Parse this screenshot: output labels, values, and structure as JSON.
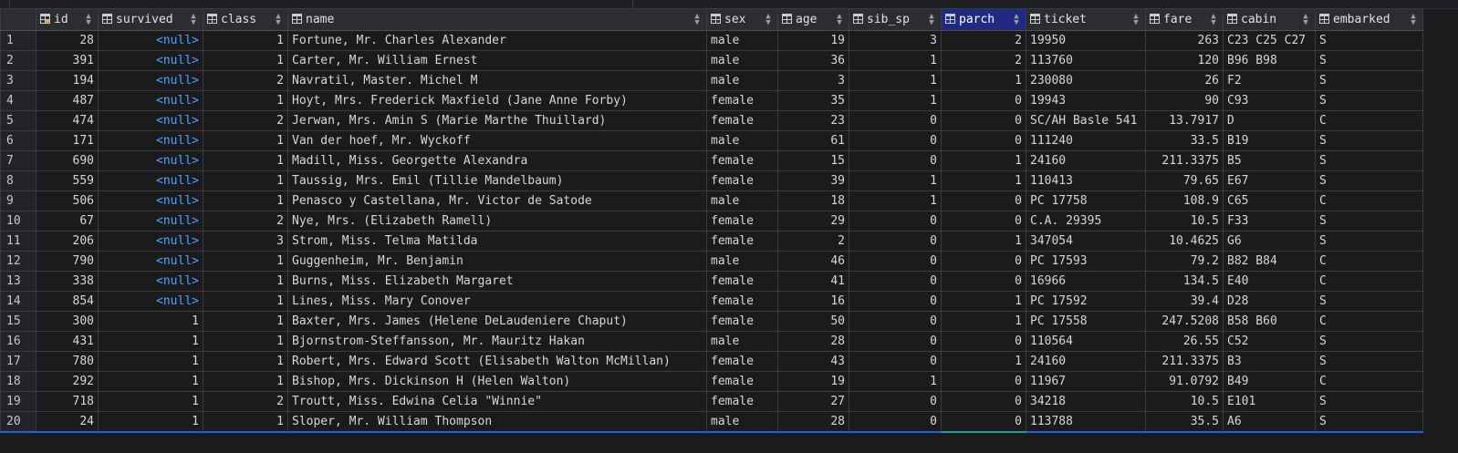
{
  "columns": [
    {
      "key": "rownum",
      "label": "",
      "align": "left",
      "icon": "none"
    },
    {
      "key": "id",
      "label": "id",
      "align": "right",
      "icon": "key-column-icon"
    },
    {
      "key": "survived",
      "label": "survived",
      "align": "right",
      "icon": "column-icon"
    },
    {
      "key": "class",
      "label": "class",
      "align": "right",
      "icon": "column-icon"
    },
    {
      "key": "name",
      "label": "name",
      "align": "left",
      "icon": "column-icon"
    },
    {
      "key": "sex",
      "label": "sex",
      "align": "left",
      "icon": "column-icon"
    },
    {
      "key": "age",
      "label": "age",
      "align": "right",
      "icon": "column-icon"
    },
    {
      "key": "sib_sp",
      "label": "sib_sp",
      "align": "right",
      "icon": "column-icon"
    },
    {
      "key": "parch",
      "label": "parch",
      "align": "right",
      "icon": "column-icon",
      "selected": true
    },
    {
      "key": "ticket",
      "label": "ticket",
      "align": "left",
      "icon": "column-icon"
    },
    {
      "key": "fare",
      "label": "fare",
      "align": "right",
      "icon": "column-icon"
    },
    {
      "key": "cabin",
      "label": "cabin",
      "align": "left",
      "icon": "column-icon"
    },
    {
      "key": "embarked",
      "label": "embarked",
      "align": "left",
      "icon": "column-icon"
    }
  ],
  "null_label": "<null>",
  "rows": [
    [
      "1",
      "28",
      null,
      "1",
      "Fortune, Mr. Charles Alexander",
      "male",
      "19",
      "3",
      "2",
      "19950",
      "263",
      "C23 C25 C27",
      "S"
    ],
    [
      "2",
      "391",
      null,
      "1",
      "Carter, Mr. William Ernest",
      "male",
      "36",
      "1",
      "2",
      "113760",
      "120",
      "B96 B98",
      "S"
    ],
    [
      "3",
      "194",
      null,
      "2",
      "Navratil, Master. Michel M",
      "male",
      "3",
      "1",
      "1",
      "230080",
      "26",
      "F2",
      "S"
    ],
    [
      "4",
      "487",
      null,
      "1",
      "Hoyt, Mrs. Frederick Maxfield (Jane Anne Forby)",
      "female",
      "35",
      "1",
      "0",
      "19943",
      "90",
      "C93",
      "S"
    ],
    [
      "5",
      "474",
      null,
      "2",
      "Jerwan, Mrs. Amin S (Marie Marthe Thuillard)",
      "female",
      "23",
      "0",
      "0",
      "SC/AH Basle 541",
      "13.7917",
      "D",
      "C"
    ],
    [
      "6",
      "171",
      null,
      "1",
      "Van der hoef, Mr. Wyckoff",
      "male",
      "61",
      "0",
      "0",
      "111240",
      "33.5",
      "B19",
      "S"
    ],
    [
      "7",
      "690",
      null,
      "1",
      "Madill, Miss. Georgette Alexandra",
      "female",
      "15",
      "0",
      "1",
      "24160",
      "211.3375",
      "B5",
      "S"
    ],
    [
      "8",
      "559",
      null,
      "1",
      "Taussig, Mrs. Emil (Tillie Mandelbaum)",
      "female",
      "39",
      "1",
      "1",
      "110413",
      "79.65",
      "E67",
      "S"
    ],
    [
      "9",
      "506",
      null,
      "1",
      "Penasco y Castellana, Mr. Victor de Satode",
      "male",
      "18",
      "1",
      "0",
      "PC 17758",
      "108.9",
      "C65",
      "C"
    ],
    [
      "10",
      "67",
      null,
      "2",
      "Nye, Mrs. (Elizabeth Ramell)",
      "female",
      "29",
      "0",
      "0",
      "C.A. 29395",
      "10.5",
      "F33",
      "S"
    ],
    [
      "11",
      "206",
      null,
      "3",
      "Strom, Miss. Telma Matilda",
      "female",
      "2",
      "0",
      "1",
      "347054",
      "10.4625",
      "G6",
      "S"
    ],
    [
      "12",
      "790",
      null,
      "1",
      "Guggenheim, Mr. Benjamin",
      "male",
      "46",
      "0",
      "0",
      "PC 17593",
      "79.2",
      "B82 B84",
      "C"
    ],
    [
      "13",
      "338",
      null,
      "1",
      "Burns, Miss. Elizabeth Margaret",
      "female",
      "41",
      "0",
      "0",
      "16966",
      "134.5",
      "E40",
      "C"
    ],
    [
      "14",
      "854",
      null,
      "1",
      "Lines, Miss. Mary Conover",
      "female",
      "16",
      "0",
      "1",
      "PC 17592",
      "39.4",
      "D28",
      "S"
    ],
    [
      "15",
      "300",
      "1",
      "1",
      "Baxter, Mrs. James (Helene DeLaudeniere Chaput)",
      "female",
      "50",
      "0",
      "1",
      "PC 17558",
      "247.5208",
      "B58 B60",
      "C"
    ],
    [
      "16",
      "431",
      "1",
      "1",
      "Bjornstrom-Steffansson, Mr. Mauritz Hakan",
      "male",
      "28",
      "0",
      "0",
      "110564",
      "26.55",
      "C52",
      "S"
    ],
    [
      "17",
      "780",
      "1",
      "1",
      "Robert, Mrs. Edward Scott (Elisabeth Walton McMillan)",
      "female",
      "43",
      "0",
      "1",
      "24160",
      "211.3375",
      "B3",
      "S"
    ],
    [
      "18",
      "292",
      "1",
      "1",
      "Bishop, Mrs. Dickinson H (Helen Walton)",
      "female",
      "19",
      "1",
      "0",
      "11967",
      "91.0792",
      "B49",
      "C"
    ],
    [
      "19",
      "718",
      "1",
      "2",
      "Troutt, Miss. Edwina Celia \"Winnie\"",
      "female",
      "27",
      "0",
      "0",
      "34218",
      "10.5",
      "E101",
      "S"
    ],
    [
      "20",
      "24",
      "1",
      "1",
      "Sloper, Mr. William Thompson",
      "male",
      "28",
      "0",
      "0",
      "113788",
      "35.5",
      "A6",
      "S"
    ]
  ],
  "colors": {
    "background": "#1b1b1d",
    "header": "#2b2d30",
    "selected_header": "#1f2a80",
    "null_text": "#4fa3ff",
    "grid": "#3a3c40"
  }
}
